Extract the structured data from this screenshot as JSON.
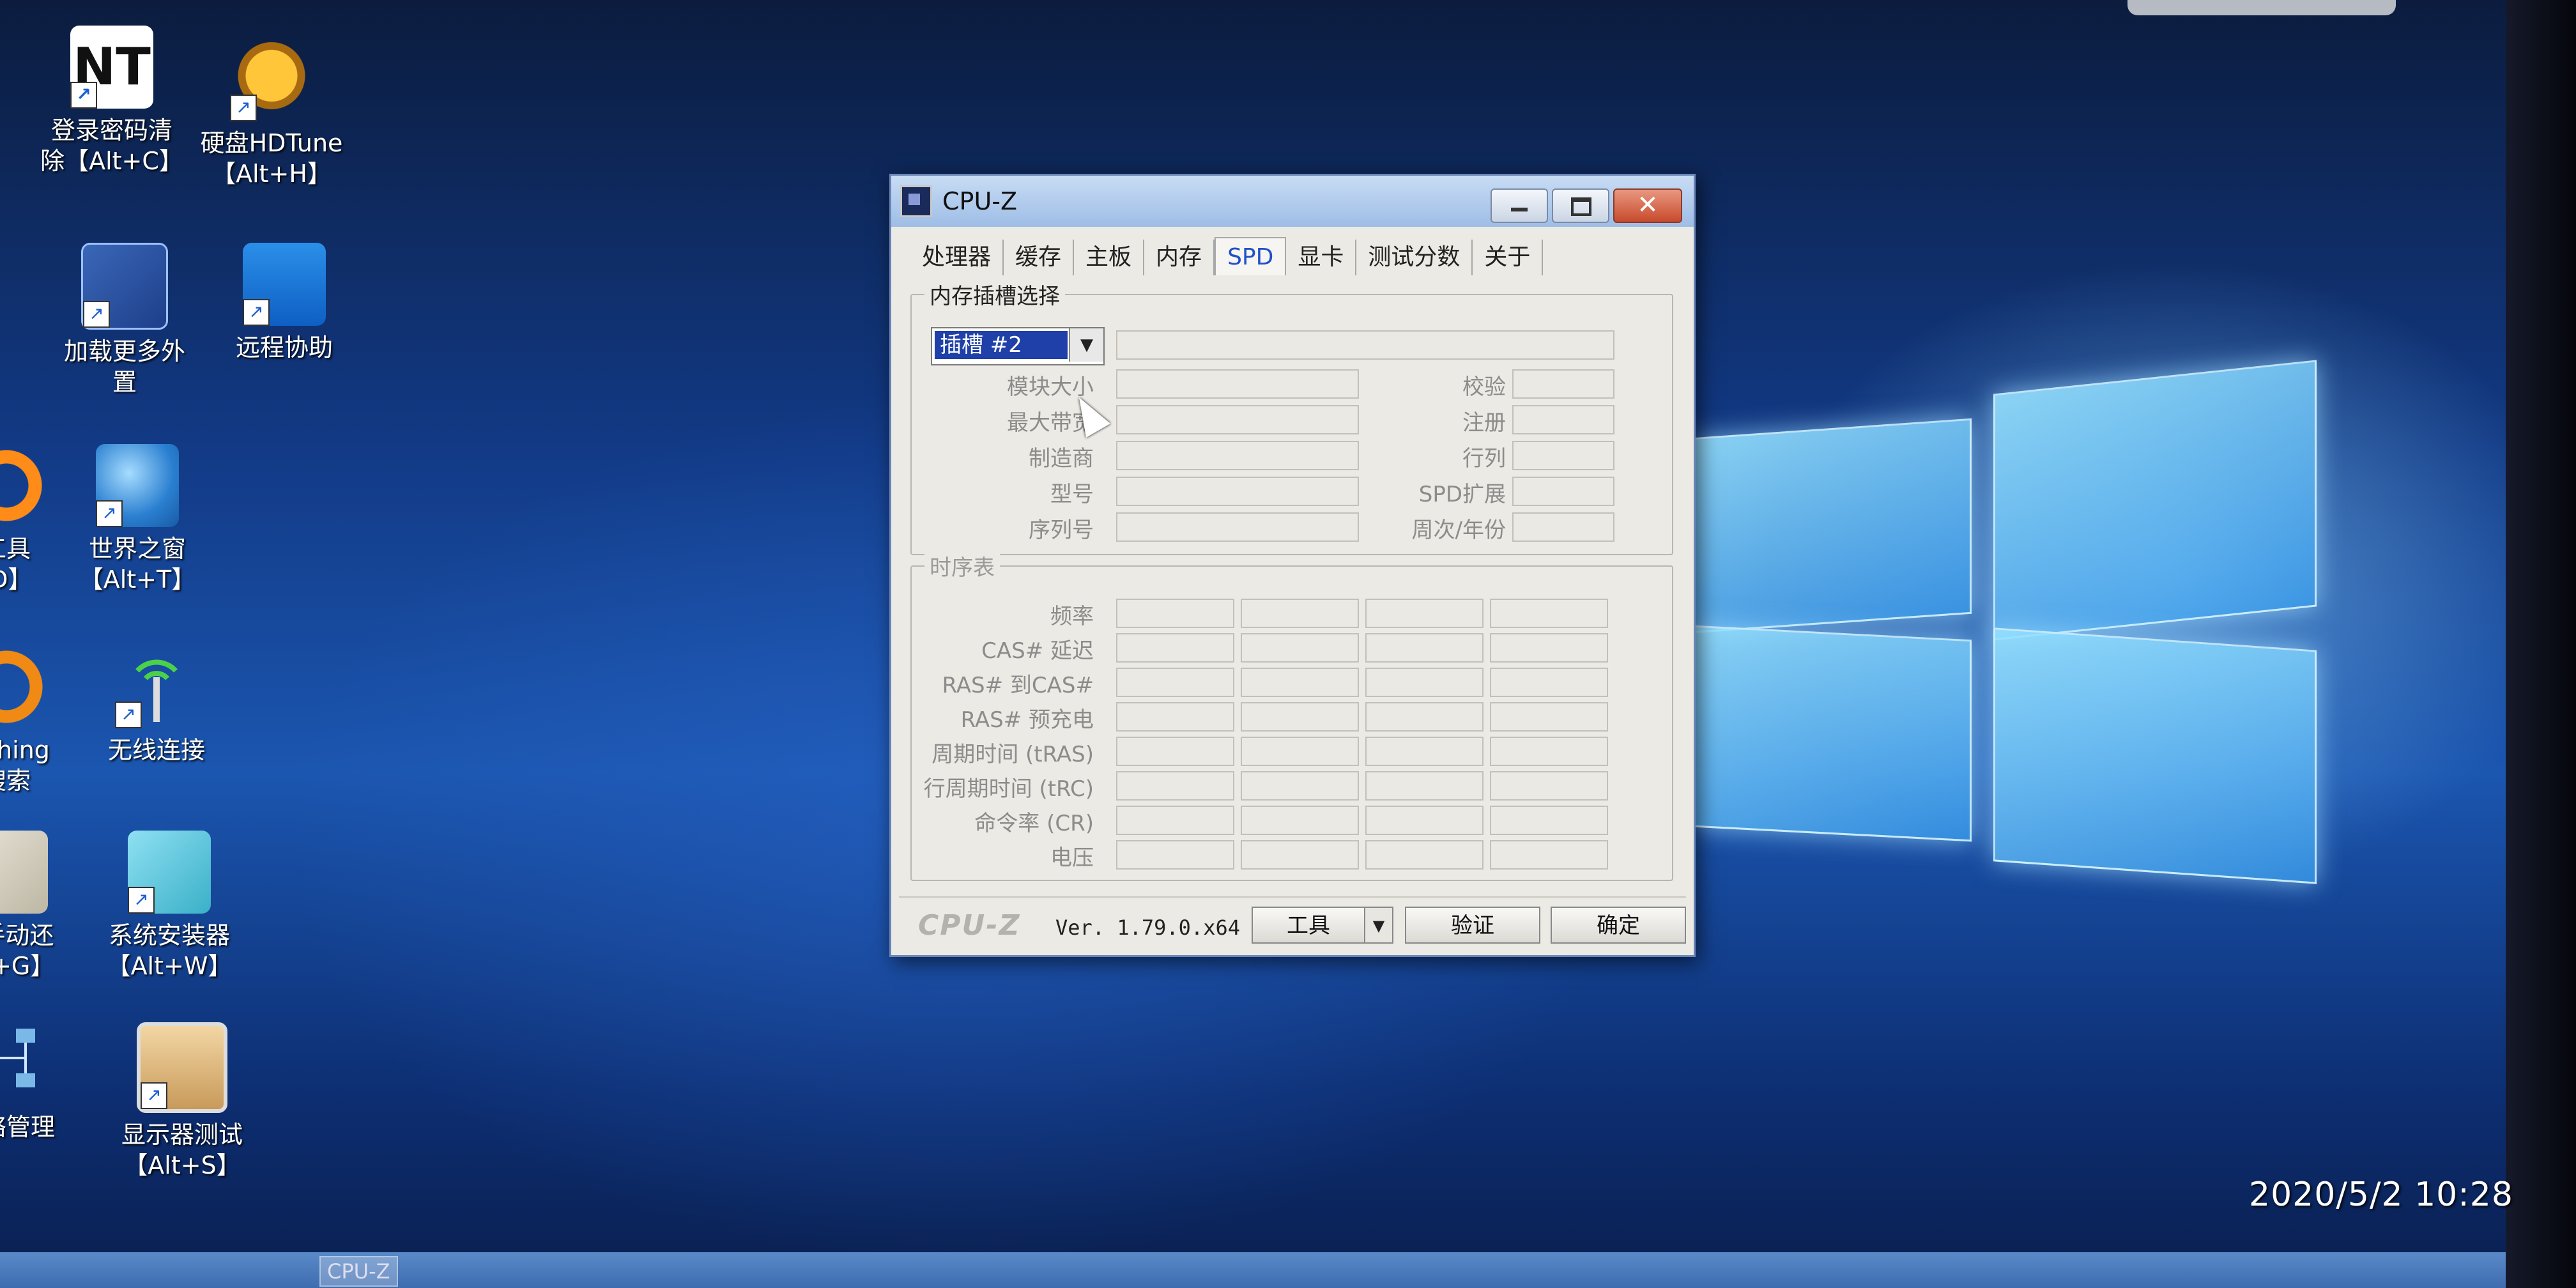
{
  "desktop": {
    "icons": [
      {
        "label": "登录密码清\n除【Alt+C】"
      },
      {
        "label": "硬盘HDTune\n【Alt+H】"
      },
      {
        "label": "加载更多外\n置"
      },
      {
        "label": "远程协助"
      },
      {
        "label": "世界之窗\n【Alt+T】"
      },
      {
        "label": "无线连接"
      },
      {
        "label": "系统安装器\n【Alt+W】"
      },
      {
        "label": "显示器测试\n【Alt+S】"
      },
      {
        "label": "工具\n-D】"
      },
      {
        "label": "rything\n搜索"
      },
      {
        "label": "st手动还\nAlt+G】"
      },
      {
        "label": "网络管理"
      }
    ]
  },
  "window": {
    "title": "CPU-Z",
    "close_glyph": "✕",
    "tabs": [
      "处理器",
      "缓存",
      "主板",
      "内存",
      "SPD",
      "显卡",
      "测试分数",
      "关于"
    ],
    "active_tab": "SPD",
    "slot_group": {
      "legend": "内存插槽选择",
      "slot_value": "插槽 #2",
      "left_labels": [
        "模块大小",
        "最大带宽",
        "制造商",
        "型号",
        "序列号"
      ],
      "right_labels": [
        "校验",
        "注册",
        "行列",
        "SPD扩展",
        "周次/年份"
      ]
    },
    "timing_group": {
      "legend": "时序表",
      "row_labels": [
        "频率",
        "CAS# 延迟",
        "RAS# 到CAS#",
        "RAS# 预充电",
        "周期时间 (tRAS)",
        "行周期时间 (tRC)",
        "命令率 (CR)",
        "电压"
      ]
    },
    "footer": {
      "brand": "CPU-Z",
      "version": "Ver. 1.79.0.x64",
      "tools_label": "工具",
      "validate_label": "验证",
      "ok_label": "确定"
    }
  },
  "clock": {
    "datetime": "2020/5/2  10:28"
  },
  "taskbar": {
    "active_app": "CPU-Z"
  }
}
